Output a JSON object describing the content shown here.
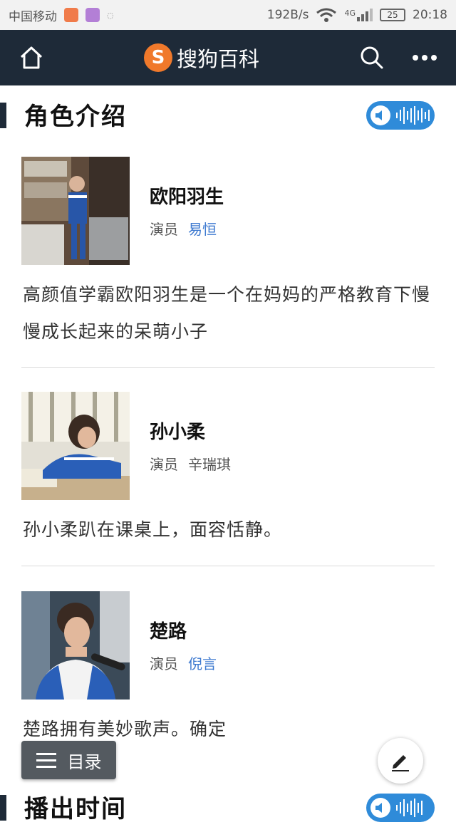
{
  "status_bar": {
    "carrier": "中国移动",
    "speed": "192B/s",
    "network": "4G",
    "battery": "25",
    "time": "20:18"
  },
  "header": {
    "logo_letter": "S",
    "title": "搜狗百科",
    "icons": [
      "home-icon",
      "search-icon",
      "more-icon"
    ]
  },
  "sections": {
    "roles": {
      "title": "角色介绍"
    },
    "airtime": {
      "title": "播出时间"
    }
  },
  "characters": [
    {
      "name": "欧阳羽生",
      "actor_label": "演员",
      "actor": "易恒",
      "actor_linked": true,
      "description": "高颜值学霸欧阳羽生是一个在妈妈的严格教育下慢慢成长起来的呆萌小子"
    },
    {
      "name": "孙小柔",
      "actor_label": "演员",
      "actor": "辛瑞琪",
      "actor_linked": false,
      "description": "孙小柔趴在课桌上，面容恬静。"
    },
    {
      "name": "楚路",
      "actor_label": "演员",
      "actor": "倪言",
      "actor_linked": true,
      "description": "楚路拥有美妙歌声。确定"
    }
  ],
  "toc": {
    "label": "目录"
  },
  "colors": {
    "header_bg": "#1e2a38",
    "accent": "#f0792b",
    "link": "#3e7ad0",
    "audio": "#2f8bd9"
  }
}
